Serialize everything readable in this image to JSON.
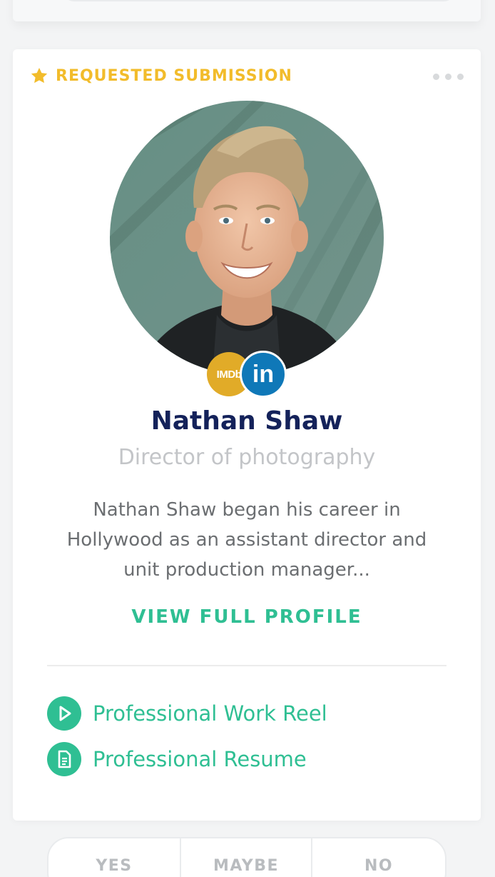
{
  "card": {
    "badge_label": "REQUESTED SUBMISSION",
    "badge_icon": "star-icon",
    "menu_icon": "more-horizontal-icon",
    "profile": {
      "name": "Nathan Shaw",
      "role": "Director of photography",
      "bio": "Nathan Shaw began his career in Hollywood as an assistant director and unit production manager...",
      "view_profile_label": "VIEW FULL PROFILE",
      "social": {
        "imdb_label": "IMDb",
        "linkedin_label": "in"
      }
    },
    "links": [
      {
        "label": "Professional Work Reel",
        "icon": "play-icon"
      },
      {
        "label": "Professional Resume",
        "icon": "document-icon"
      }
    ]
  },
  "actions": {
    "yes_label": "YES",
    "maybe_label": "MAYBE",
    "no_label": "NO"
  },
  "colors": {
    "accent_green": "#2fbf93",
    "highlight_yellow": "#f2bc2b",
    "name_navy": "#14225a",
    "imdb_yellow": "#e1ab28",
    "linkedin_blue": "#0f78b8"
  }
}
